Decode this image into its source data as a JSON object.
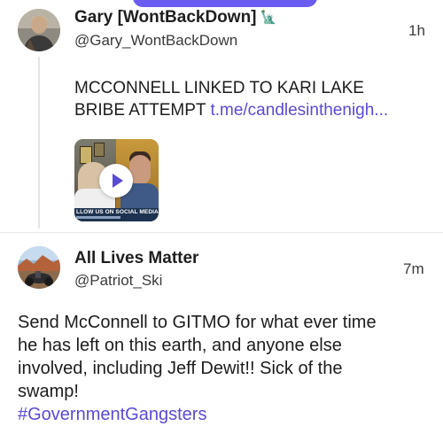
{
  "post1": {
    "display_name": "Gary [WontBackDown]",
    "name_emoji": "🗽",
    "handle": "@Gary_WontBackDown",
    "time": "1h",
    "text_line1": "MCCONNELL LINKED TO KARI LAKE",
    "text_line2": "BRIBE ATTEMPT",
    "link_text": "t.me/candlesinthenigh...",
    "thumbnail_caption": "LLOW US ON SOCIAL MEDIA"
  },
  "post2": {
    "display_name": "All Lives Matter",
    "handle": "@Patriot_Ski",
    "time": "7m",
    "text_lines": [
      "Send McConnell to GITMO for what ever time",
      "he has left on this earth, and anyone else",
      "involved, including Jeff Dewit!! Sick of the",
      "swamp!"
    ],
    "hashtag": "#GovernmentGangsters"
  },
  "colors": {
    "accent": "#5a4bd4",
    "pill": "#6a5cf0",
    "thread_line": "#e6e6e6"
  },
  "icons": [
    "statue-of-liberty-emoji",
    "play-icon"
  ]
}
